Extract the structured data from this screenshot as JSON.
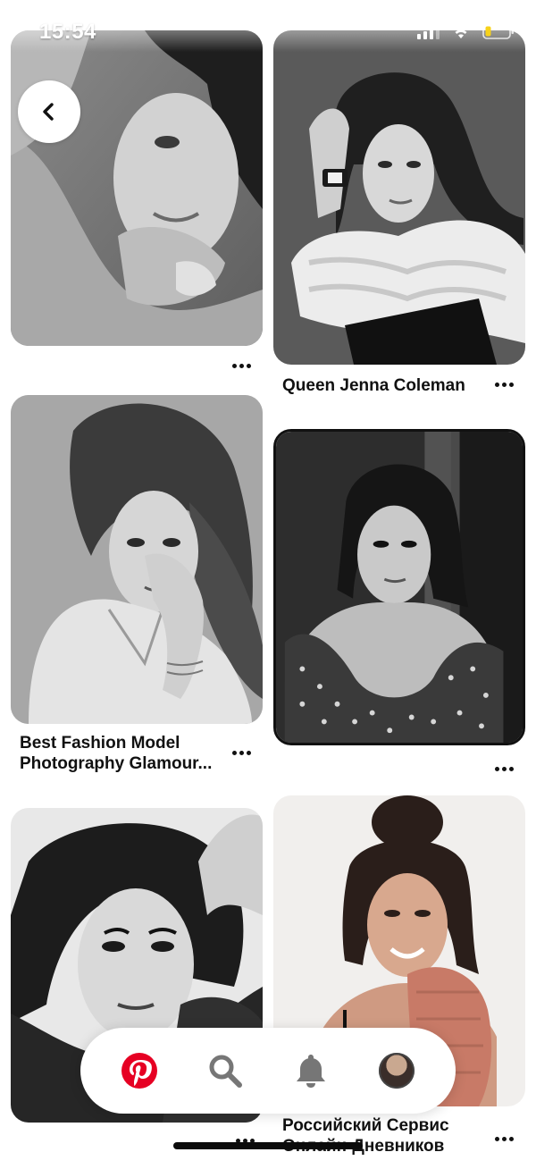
{
  "status_bar": {
    "time": "15:54"
  },
  "navigation": {
    "back_icon": "chevron-left-icon"
  },
  "pins": {
    "left": [
      {
        "title": "",
        "image": "bw-portrait-woman-sweater-hand-on-face"
      },
      {
        "title": "Best Fashion Model Photography Glamour...",
        "image": "bw-portrait-wavy-hair-white-shirt"
      },
      {
        "title": "",
        "image": "bw-portrait-dark-sweater-hand-in-hair"
      }
    ],
    "right": [
      {
        "title": "Queen Jenna Coleman",
        "image": "bw-portrait-cable-knit-sweater-wristwatch"
      },
      {
        "title": "",
        "image": "bw-portrait-polka-dot-off-shoulder"
      },
      {
        "title": "Российский Сервис Онлайн-Дневников",
        "image": "color-portrait-messy-bun-pink-sweater"
      }
    ]
  },
  "bottom_nav": {
    "items": [
      {
        "icon": "pinterest-logo-icon",
        "active": true
      },
      {
        "icon": "search-icon",
        "active": false
      },
      {
        "icon": "bell-icon",
        "active": false
      },
      {
        "icon": "profile-avatar",
        "active": false
      }
    ]
  },
  "colors": {
    "brand": "#e60023",
    "icon_inactive": "#767676",
    "text": "#111111"
  }
}
